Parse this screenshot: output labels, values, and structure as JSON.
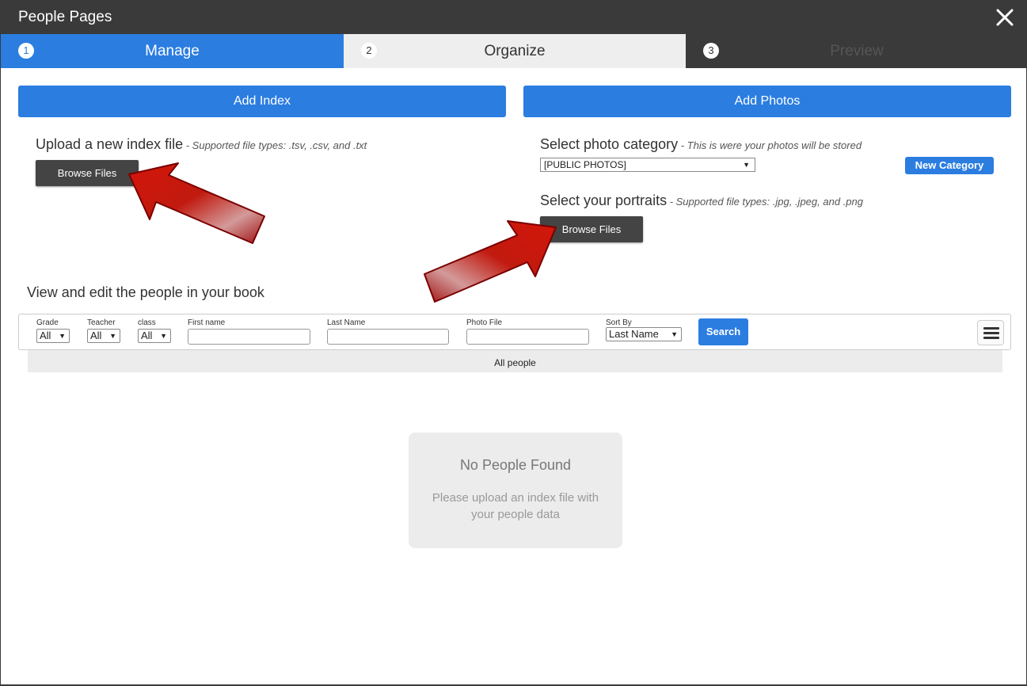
{
  "window": {
    "title": "People Pages",
    "close_icon": "close-icon"
  },
  "steps": [
    {
      "number": "1",
      "label": "Manage",
      "state": "active"
    },
    {
      "number": "2",
      "label": "Organize",
      "state": "inactive"
    },
    {
      "number": "3",
      "label": "Preview",
      "state": "disabled"
    }
  ],
  "index_section": {
    "button_label": "Add Index",
    "heading": "Upload a new index file",
    "note": " - Supported file types: .tsv, .csv, and .txt",
    "browse_label": "Browse Files"
  },
  "photos_section": {
    "button_label": "Add Photos",
    "category_heading": "Select photo category",
    "category_note": " - This is were your photos will be stored",
    "category_selected": "[PUBLIC PHOTOS]",
    "new_category_label": "New Category",
    "portraits_heading": "Select your portraits",
    "portraits_note": " - Supported file types: .jpg, .jpeg, and .png",
    "browse_label": "Browse Files"
  },
  "people_section": {
    "heading": "View and edit the people in your book",
    "filters": {
      "grade": {
        "label": "Grade",
        "value": "All"
      },
      "teacher": {
        "label": "Teacher",
        "value": "All"
      },
      "class": {
        "label": "class",
        "value": "All"
      },
      "first_name": {
        "label": "First name",
        "value": ""
      },
      "last_name": {
        "label": "Last Name",
        "value": ""
      },
      "photo_file": {
        "label": "Photo File",
        "value": ""
      },
      "sort_by": {
        "label": "Sort By",
        "value": "Last Name"
      }
    },
    "search_label": "Search",
    "menu_icon": "hamburger-menu-icon",
    "group_label": "All people",
    "empty_title": "No People Found",
    "empty_message": "Please upload an index file with your people data"
  },
  "colors": {
    "accent": "#2b7de0",
    "titlebar": "#3a3a3a",
    "annotation_arrow": "#cc1a0e"
  }
}
